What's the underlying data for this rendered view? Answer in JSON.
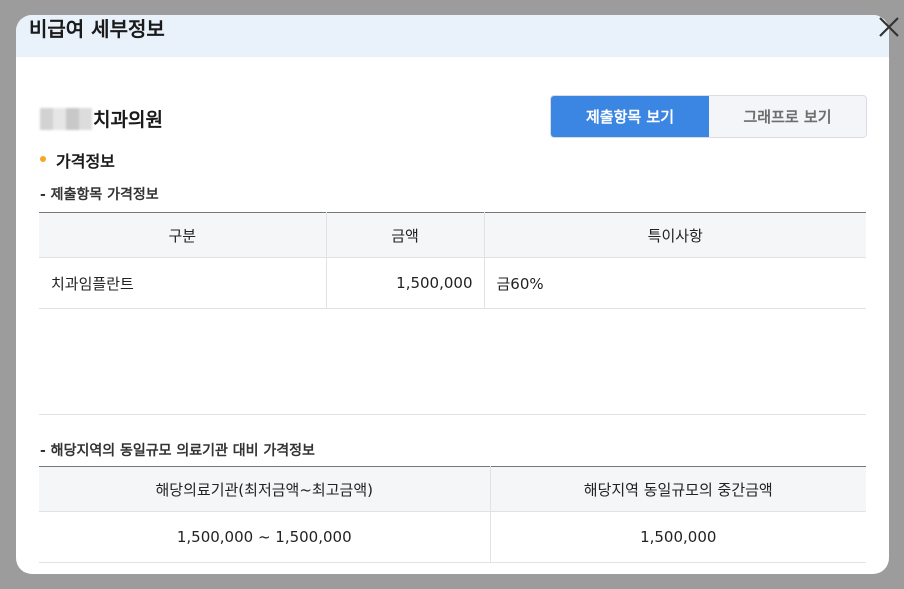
{
  "modal": {
    "title": "비급여 세부정보"
  },
  "hospital": {
    "name": "치과의원"
  },
  "view_toggle": {
    "items": [
      {
        "label": "제출항목 보기",
        "active": true
      },
      {
        "label": "그래프로 보기",
        "active": false
      }
    ]
  },
  "price_section": {
    "heading": "가격정보",
    "bullet_color": "#f5a623"
  },
  "submitted_table": {
    "caption": "- 제출항목 가격정보",
    "headers": [
      "구분",
      "금액",
      "특이사항"
    ],
    "rows": [
      {
        "category": "치과임플란트",
        "amount": "1,500,000",
        "note": "금60%"
      }
    ]
  },
  "regional_table": {
    "caption": "- 해당지역의 동일규모 의료기관 대비 가격정보",
    "headers": [
      "해당의료기관(최저금액~최고금액)",
      "해당지역 동일규모의 중간금액"
    ],
    "rows": [
      {
        "range": "1,500,000 ~ 1,500,000",
        "median": "1,500,000"
      }
    ]
  },
  "colors": {
    "accent": "#3b85e3",
    "header_bg": "#e9f1fb"
  },
  "icons": {
    "close": "close-icon"
  }
}
